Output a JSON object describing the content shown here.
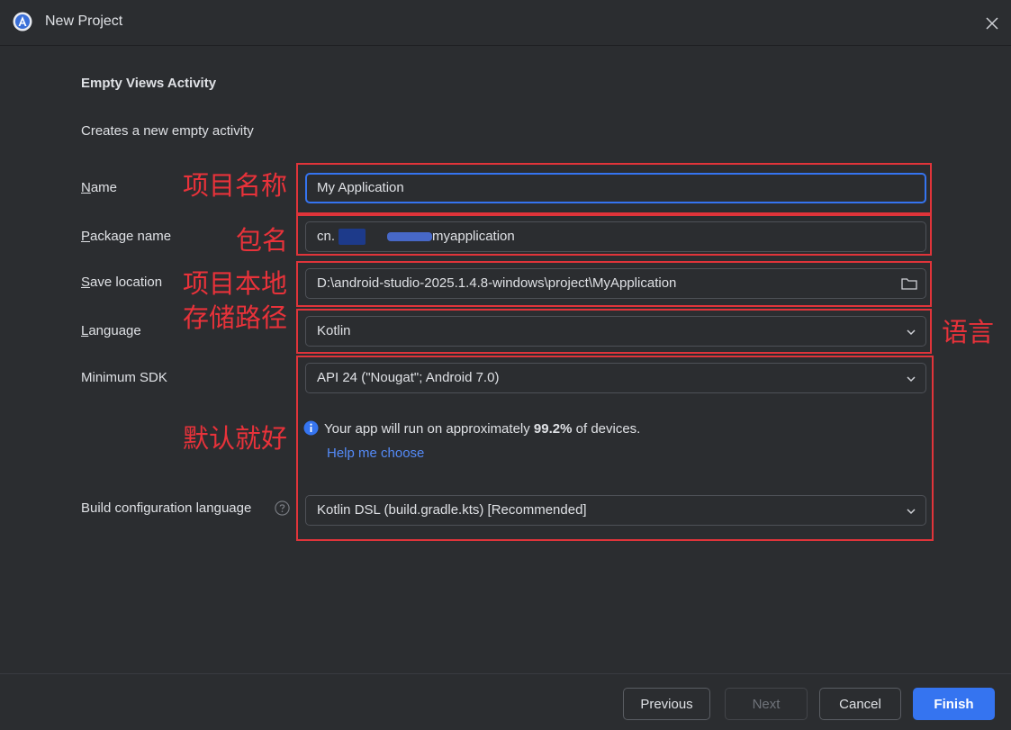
{
  "window": {
    "title": "New Project"
  },
  "template": {
    "heading": "Empty Views Activity",
    "description": "Creates a new empty activity"
  },
  "form": {
    "name": {
      "label_first": "N",
      "label_rest": "ame",
      "value": "My Application"
    },
    "package": {
      "label_first": "P",
      "label_rest": "ackage name",
      "value_prefix": "cn.",
      "value_suffix": "myapplication"
    },
    "save_location": {
      "label_first": "S",
      "label_rest": "ave location",
      "value": "D:\\android-studio-2025.1.4.8-windows\\project\\MyApplication"
    },
    "language": {
      "label_first": "L",
      "label_rest": "anguage",
      "value": "Kotlin"
    },
    "min_sdk": {
      "label": "Minimum SDK",
      "value": "API 24 (\"Nougat\"; Android 7.0)"
    },
    "sdk_info": {
      "prefix": "Your app will run on approximately ",
      "percent": "99.2%",
      "suffix": " of devices."
    },
    "help_link": "Help me choose",
    "build_config": {
      "label": "Build configuration language",
      "value": "Kotlin DSL (build.gradle.kts) [Recommended]"
    }
  },
  "annotations": {
    "name": "项目名称",
    "package": "包名",
    "location_line1": "项目本地",
    "location_line2": "存储路径",
    "language": "语言",
    "defaults": "默认就好"
  },
  "buttons": {
    "previous": "Previous",
    "next": "Next",
    "cancel": "Cancel",
    "finish": "Finish"
  },
  "colors": {
    "background": "#2b2d30",
    "accent": "#3574f0",
    "link": "#548af7",
    "annotation": "#e0343a"
  },
  "icons": [
    "android-studio-icon",
    "close-icon",
    "folder-icon",
    "chevron-down-icon",
    "info-icon",
    "question-icon"
  ]
}
